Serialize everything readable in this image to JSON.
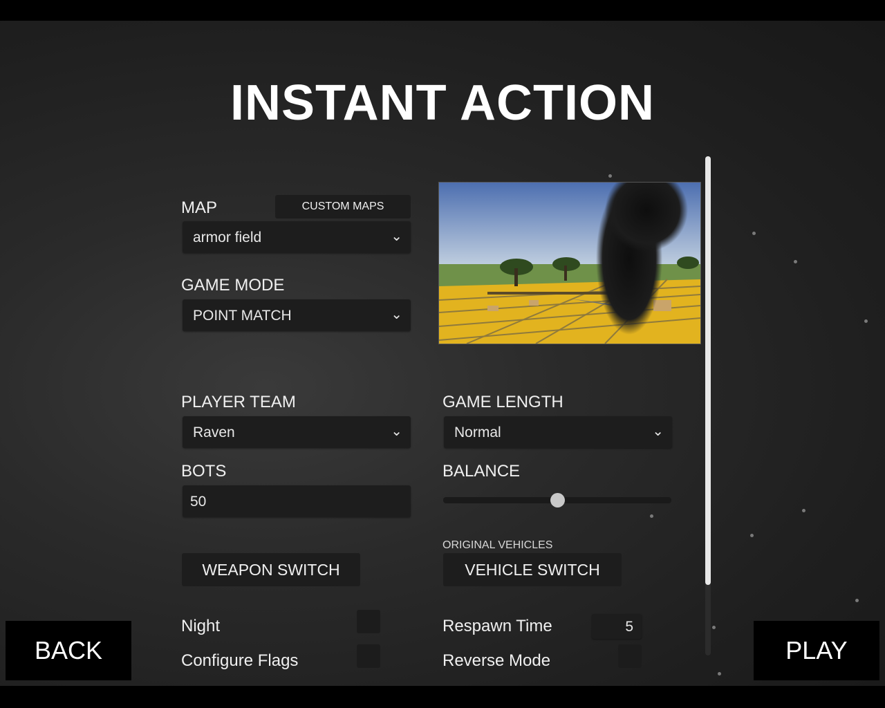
{
  "title": "INSTANT ACTION",
  "map": {
    "label": "MAP",
    "custom_maps_label": "CUSTOM MAPS",
    "selected": "armor field"
  },
  "game_mode": {
    "label": "GAME MODE",
    "selected": "POINT MATCH"
  },
  "player_team": {
    "label": "PLAYER TEAM",
    "selected": "Raven"
  },
  "game_length": {
    "label": "GAME LENGTH",
    "selected": "Normal"
  },
  "bots": {
    "label": "BOTS",
    "value": "50"
  },
  "balance": {
    "label": "BALANCE",
    "value": 0.5
  },
  "weapon_switch_label": "WEAPON SWITCH",
  "vehicles": {
    "caption": "ORIGINAL VEHICLES",
    "button_label": "VEHICLE SWITCH"
  },
  "night": {
    "label": "Night"
  },
  "configure_flags": {
    "label": "Configure Flags"
  },
  "respawn_time": {
    "label": "Respawn Time",
    "value": "5"
  },
  "reverse_mode": {
    "label": "Reverse Mode"
  },
  "nav": {
    "back_label": "BACK",
    "play_label": "PLAY"
  },
  "icons": {
    "dropdown_arrow": "chevron-down-icon"
  }
}
